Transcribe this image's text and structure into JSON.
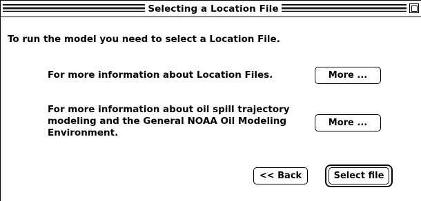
{
  "window": {
    "title": "Selecting a Location File"
  },
  "main": {
    "intro_text": "To run the model you need to select a Location File.",
    "info_location_files": "For more information about Location Files.",
    "info_oil_spill": "For more information about oil spill trajectory modeling and the General NOAA Oil Modeling Environment."
  },
  "buttons": {
    "more_location_label": "More ...",
    "more_oil_spill_label": "More ...",
    "back_label": "<< Back",
    "select_file_label": "Select file"
  }
}
